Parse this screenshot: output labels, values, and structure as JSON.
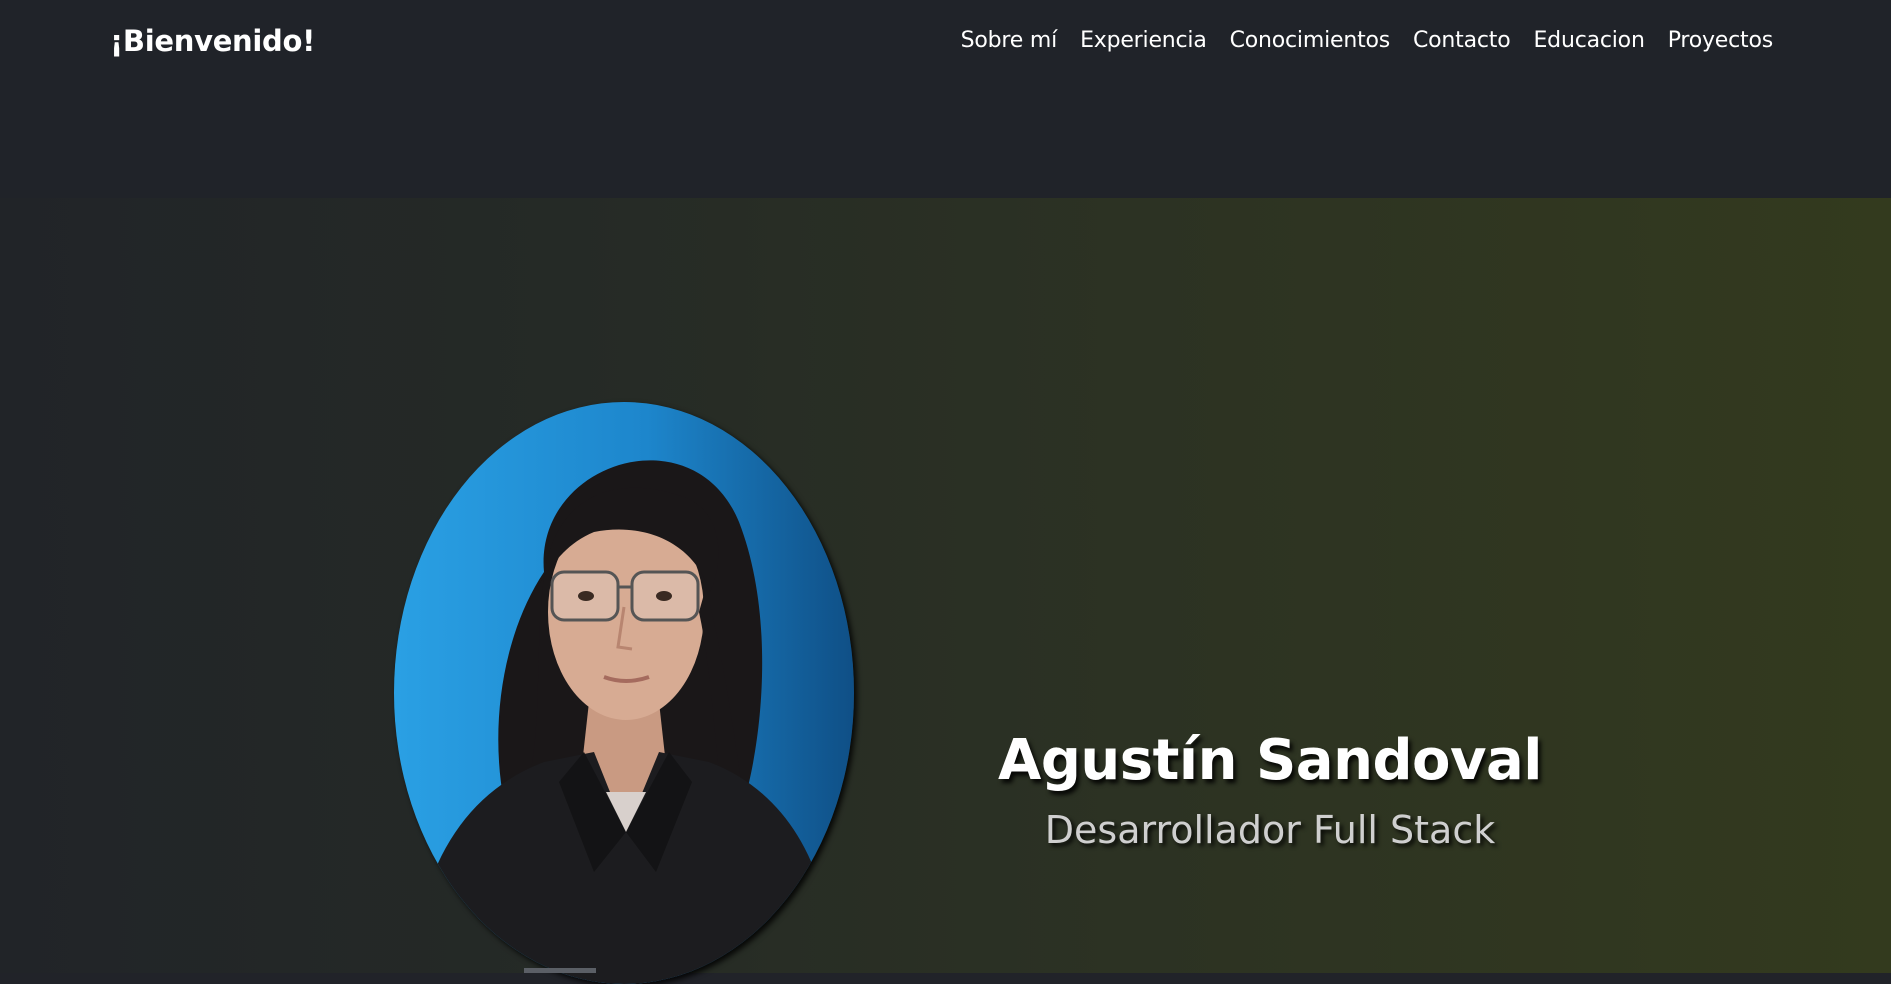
{
  "navbar": {
    "brand": "¡Bienvenido!",
    "links": [
      {
        "label": "Sobre mí"
      },
      {
        "label": "Experiencia"
      },
      {
        "label": "Conocimientos"
      },
      {
        "label": "Contacto"
      },
      {
        "label": "Educacion"
      },
      {
        "label": "Proyectos"
      }
    ]
  },
  "hero": {
    "name": "Agustín Sandoval",
    "title": "Desarrollador Full Stack",
    "photo_icon": "profile-photo"
  },
  "colors": {
    "navbar_bg": "#202329",
    "hero_gradient_start": "#212428",
    "hero_gradient_end": "#333a1e",
    "photo_bg": "#1e8fd6",
    "text": "#ffffff",
    "subtitle": "#cfcfcf"
  }
}
